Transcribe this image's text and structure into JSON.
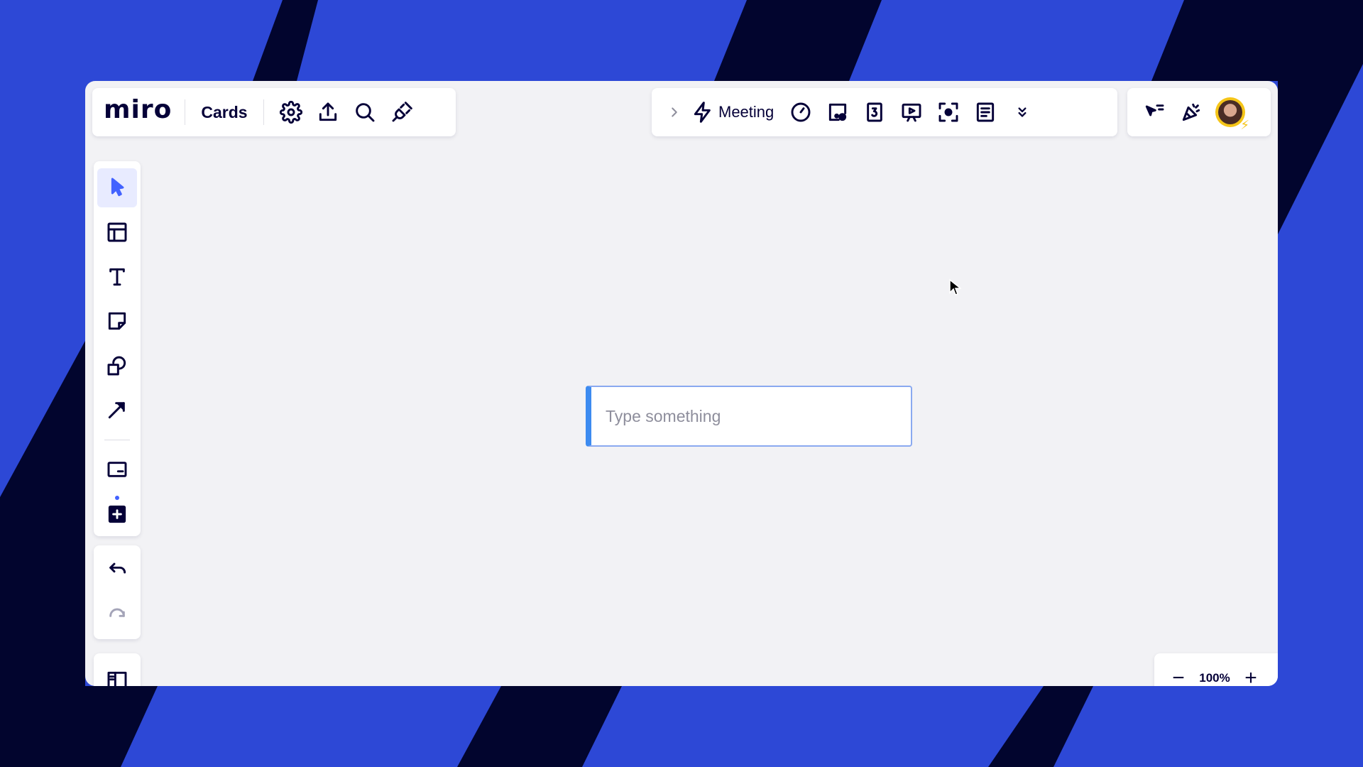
{
  "app": {
    "logo": "miro",
    "board_name": "Cards"
  },
  "toolbar_left": {
    "icons": [
      "gear-icon",
      "upload-icon",
      "search-icon",
      "plugin-icon"
    ]
  },
  "toolbar_center": {
    "meeting_label": "Meeting",
    "icons": [
      "chevron-right-icon",
      "lightning-icon",
      "timer-icon",
      "voting-icon",
      "countdown-3-icon",
      "presentation-icon",
      "focus-icon",
      "notes-icon",
      "double-chevron-down-icon"
    ]
  },
  "toolbar_right": {
    "icons": [
      "cursor-filter-icon",
      "celebrate-icon",
      "avatar"
    ]
  },
  "left_tools": {
    "items": [
      "select-icon",
      "templates-icon",
      "text-icon",
      "sticky-note-icon",
      "shapes-icon",
      "arrow-icon",
      "card-icon",
      "add-app-icon"
    ]
  },
  "history": {
    "items": [
      "undo-icon",
      "redo-icon"
    ]
  },
  "canvas": {
    "text_card_placeholder": "Type something",
    "text_card_value": ""
  },
  "zoom": {
    "level": "100%",
    "minus": "−",
    "plus": "+"
  },
  "colors": {
    "background": "#2d48d6",
    "stripe": "#02052e",
    "canvas": "#f2f2f5",
    "accent": "#4262ff",
    "card_border": "#3d8bf0"
  }
}
